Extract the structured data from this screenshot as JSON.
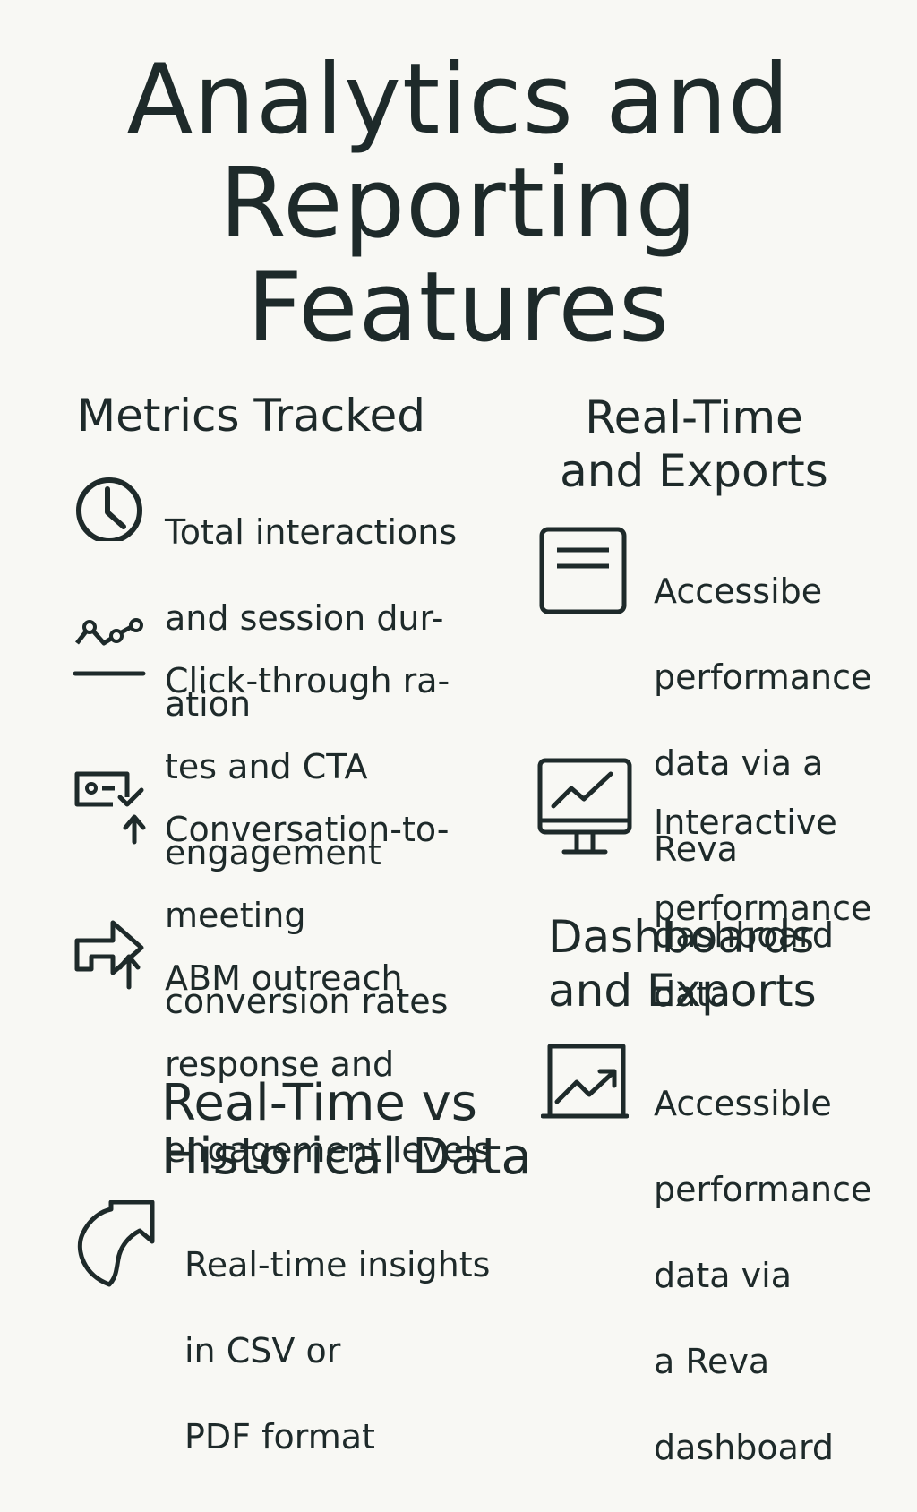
{
  "title": {
    "lines": [
      "Analytics and",
      "Reporting",
      "Features"
    ]
  },
  "left": {
    "metrics": {
      "heading": "Metrics Tracked",
      "items": [
        {
          "icon": "clock-icon",
          "lines": [
            "Total interactions",
            "and session dur-",
            "ation"
          ]
        },
        {
          "icon": "trend-line-icon",
          "lines": [
            "Click-through ra-",
            "tes and CTA",
            "engagement"
          ]
        },
        {
          "icon": "ticket-check-icon",
          "lines": [
            "Conversation-to-",
            "meeting",
            "conversion rates"
          ]
        },
        {
          "icon": "share-arrow-icon",
          "lines": [
            "ABM outreach",
            "response and",
            "engagement levels"
          ]
        }
      ]
    },
    "historical": {
      "heading_lines": [
        "Real-Time vs",
        "Historical Data"
      ],
      "items": [
        {
          "icon": "curved-arrow-icon",
          "lines": [
            "Real-time insights",
            "in CSV or",
            "PDF format"
          ]
        }
      ]
    }
  },
  "right": {
    "realtime": {
      "heading_lines": [
        "Real-Time",
        "and Exports"
      ],
      "items": [
        {
          "icon": "document-window-icon",
          "lines": [
            "Accessibe",
            "performance",
            "data via a",
            "Reva",
            "dashboard"
          ]
        },
        {
          "icon": "monitor-chart-icon",
          "lines": [
            "Interactive",
            "performance",
            "data"
          ]
        }
      ]
    },
    "dashboards": {
      "heading_lines": [
        "Dashboards",
        "and Exports"
      ],
      "items": [
        {
          "icon": "chart-frame-icon",
          "lines": [
            "Accessible",
            "performance",
            "data via",
            "a Reva",
            "dashboard"
          ]
        }
      ]
    }
  },
  "colors": {
    "background": "#f8f8f4",
    "ink": "#1e2a2a"
  }
}
